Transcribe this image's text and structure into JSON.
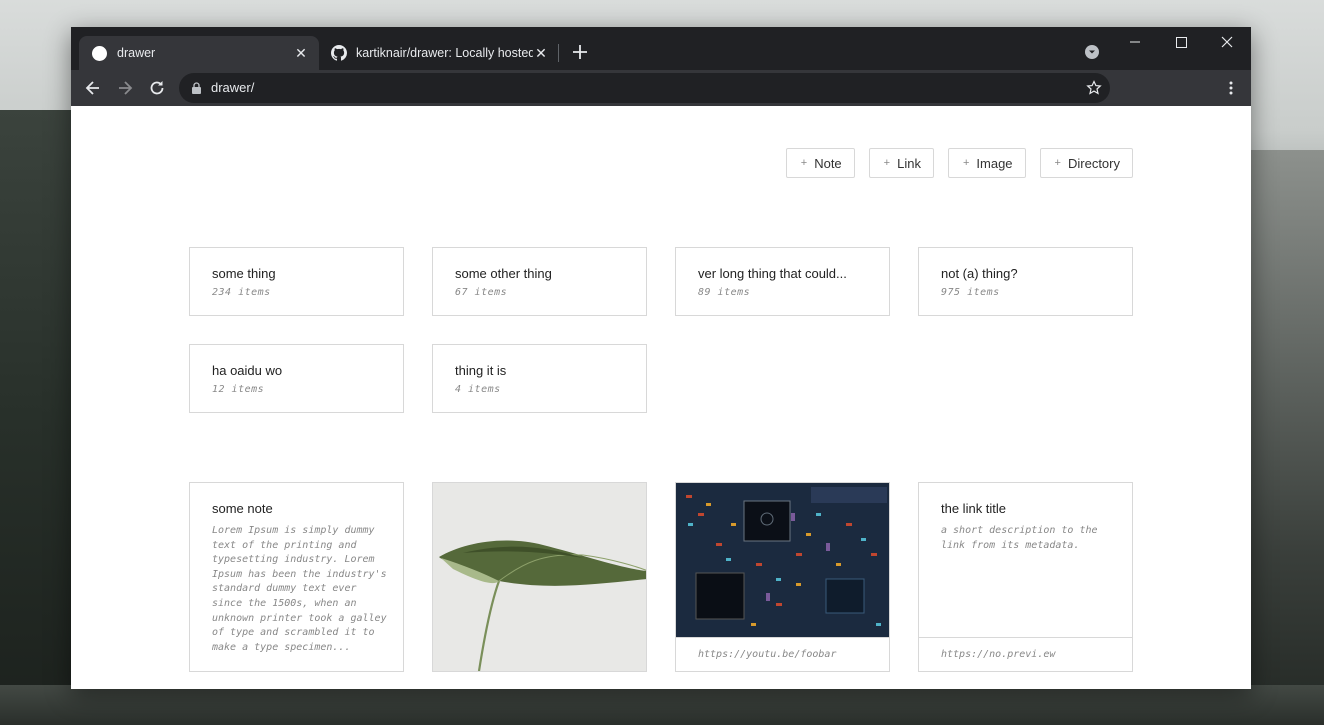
{
  "browser": {
    "tabs": [
      {
        "title": "drawer",
        "active": true
      },
      {
        "title": "kartiknair/drawer: Locally hosted",
        "active": false
      }
    ],
    "url": "drawer/"
  },
  "actions": [
    {
      "label": "Note"
    },
    {
      "label": "Link"
    },
    {
      "label": "Image"
    },
    {
      "label": "Directory"
    }
  ],
  "directories": [
    {
      "name": "some thing",
      "count": "234 items"
    },
    {
      "name": "some other thing",
      "count": "67 items"
    },
    {
      "name": "ver long thing that could...",
      "count": "89 items"
    },
    {
      "name": "not (a) thing?",
      "count": "975 items"
    },
    {
      "name": "ha oaidu wo",
      "count": "12 items"
    },
    {
      "name": "thing it is",
      "count": "4 items"
    }
  ],
  "items": {
    "note": {
      "title": "some note",
      "body": "Lorem Ipsum is simply dummy text of the printing and typesetting industry. Lorem Ipsum has been the industry's standard dummy text ever since the 1500s, when an unknown printer took a galley of type and scrambled it to make a type specimen..."
    },
    "video": {
      "url": "https://youtu.be/foobar"
    },
    "link": {
      "title": "the link title",
      "description": "a short description to the link from its metadata.",
      "url": "https://no.previ.ew"
    }
  },
  "colors": {
    "titlebar": "#202124",
    "toolbar": "#35363a",
    "border": "#d8d8d8",
    "muted_text": "#888888"
  }
}
